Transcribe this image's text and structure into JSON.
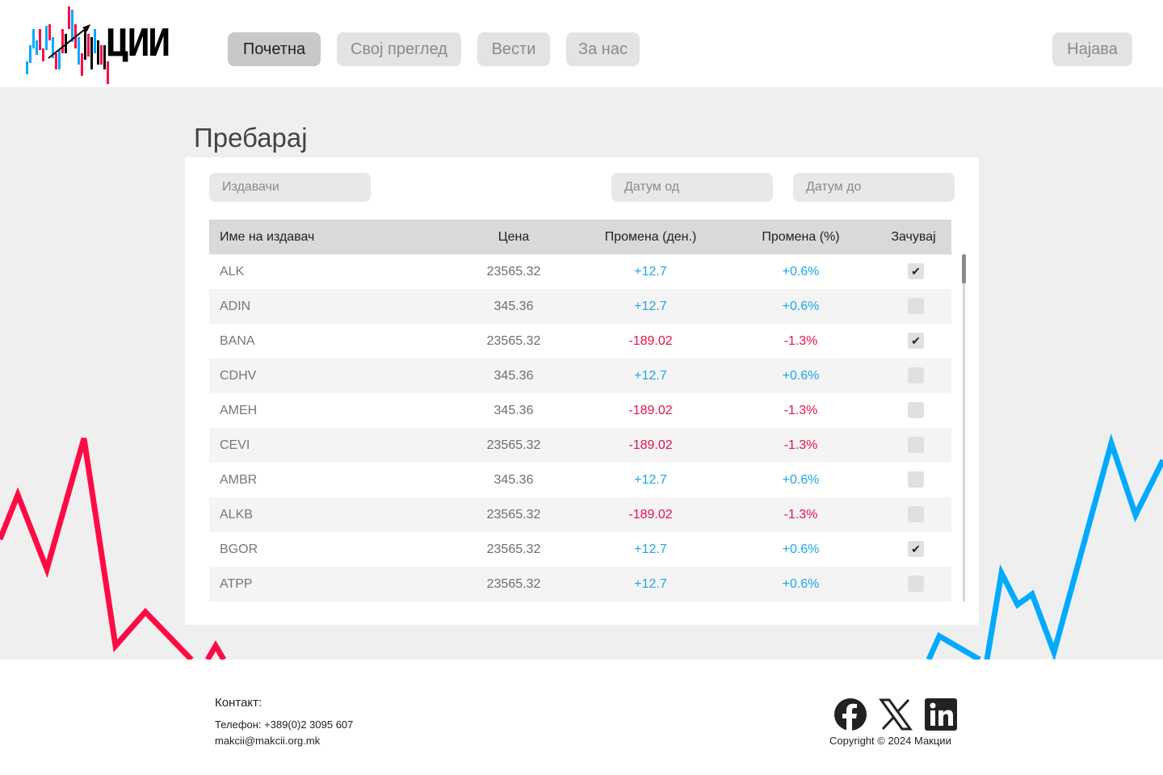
{
  "header": {
    "logo_text": "ЦИИ",
    "nav": [
      {
        "label": "Почетна",
        "active": true
      },
      {
        "label": "Свој преглед",
        "active": false
      },
      {
        "label": "Вести",
        "active": false
      },
      {
        "label": "За нас",
        "active": false
      }
    ],
    "login_label": "Најава"
  },
  "search": {
    "title": "Пребарај",
    "issuer_placeholder": "Издавачи",
    "date_from_placeholder": "Датум од",
    "date_to_placeholder": "Датум до"
  },
  "table": {
    "headers": {
      "name": "Име на издавач",
      "price": "Цена",
      "change": "Промена (ден.)",
      "change_pct": "Промена  (%)",
      "save": "Зачувај"
    },
    "rows": [
      {
        "name": "ALK",
        "price": "23565.32",
        "change": "+12.7",
        "change_pct": "+0.6%",
        "trend": "up",
        "saved": true
      },
      {
        "name": "ADIN",
        "price": "345.36",
        "change": "+12.7",
        "change_pct": "+0.6%",
        "trend": "up",
        "saved": false
      },
      {
        "name": "BANA",
        "price": "23565.32",
        "change": "-189.02",
        "change_pct": "-1.3%",
        "trend": "down",
        "saved": true
      },
      {
        "name": "CDHV",
        "price": "345.36",
        "change": "+12.7",
        "change_pct": "+0.6%",
        "trend": "up",
        "saved": false
      },
      {
        "name": "AMEH",
        "price": "345.36",
        "change": "-189.02",
        "change_pct": "-1.3%",
        "trend": "down",
        "saved": false
      },
      {
        "name": "CEVI",
        "price": "23565.32",
        "change": "-189.02",
        "change_pct": "-1.3%",
        "trend": "down",
        "saved": false
      },
      {
        "name": "AMBR",
        "price": "345.36",
        "change": "+12.7",
        "change_pct": "+0.6%",
        "trend": "up",
        "saved": false
      },
      {
        "name": "ALKB",
        "price": "23565.32",
        "change": "-189.02",
        "change_pct": "-1.3%",
        "trend": "down",
        "saved": false
      },
      {
        "name": "BGOR",
        "price": "23565.32",
        "change": "+12.7",
        "change_pct": "+0.6%",
        "trend": "up",
        "saved": true
      },
      {
        "name": "ATPP",
        "price": "23565.32",
        "change": "+12.7",
        "change_pct": "+0.6%",
        "trend": "up",
        "saved": false
      }
    ]
  },
  "footer": {
    "contact_label": "Контакт:",
    "phone": "Телефон: +389(0)2 3095 607",
    "email": "makcii@makcii.org.mk",
    "copyright": "Copyright © 2024 Макции",
    "social_icons": [
      "facebook-icon",
      "x-icon",
      "linkedin-icon"
    ]
  },
  "colors": {
    "up": "#1aa8e8",
    "down": "#e8104a",
    "deco_red": "#ff0a45",
    "deco_blue": "#00aaff"
  }
}
